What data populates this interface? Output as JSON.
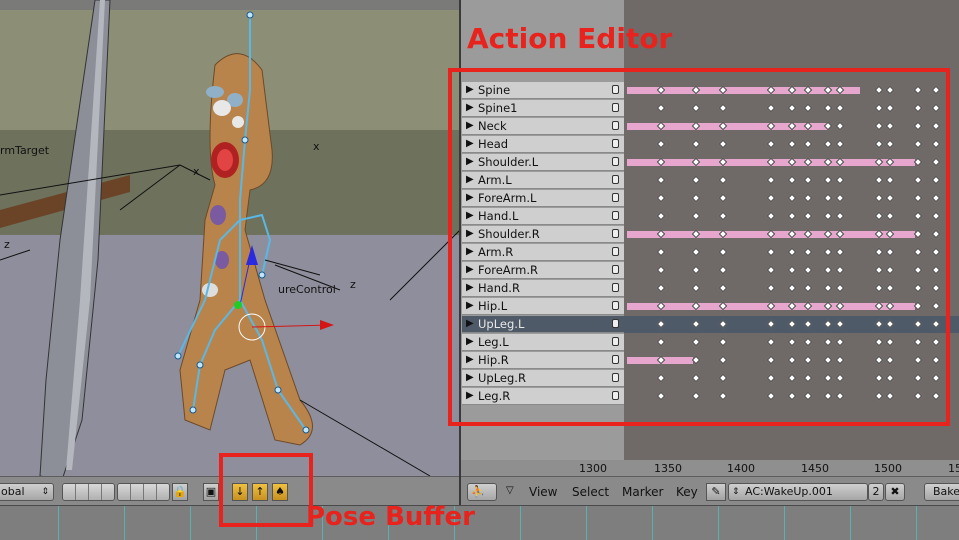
{
  "viewport": {
    "labels": {
      "target": "rmTarget",
      "control": "ureControl",
      "z1": "z",
      "z2": "z",
      "x1": "x",
      "x2": "x"
    }
  },
  "viewport_header": {
    "orientation_select": "obal",
    "lock_icon": "lock-icon"
  },
  "annotations": {
    "action_editor_label": "Action Editor",
    "pose_buffer_label": "Pose Buffer",
    "color": "#e8221c"
  },
  "action_editor": {
    "channels": [
      {
        "name": "Spine",
        "selected": false
      },
      {
        "name": "Spine1",
        "selected": false
      },
      {
        "name": "Neck",
        "selected": false
      },
      {
        "name": "Head",
        "selected": false
      },
      {
        "name": "Shoulder.L",
        "selected": false
      },
      {
        "name": "Arm.L",
        "selected": false
      },
      {
        "name": "ForeArm.L",
        "selected": false
      },
      {
        "name": "Hand.L",
        "selected": false
      },
      {
        "name": "Shoulder.R",
        "selected": false
      },
      {
        "name": "Arm.R",
        "selected": false
      },
      {
        "name": "ForeArm.R",
        "selected": false
      },
      {
        "name": "Hand.R",
        "selected": false
      },
      {
        "name": "Hip.L",
        "selected": false
      },
      {
        "name": "UpLeg.L",
        "selected": true
      },
      {
        "name": "Leg.L",
        "selected": false
      },
      {
        "name": "Hip.R",
        "selected": false
      },
      {
        "name": "UpLeg.R",
        "selected": false
      },
      {
        "name": "Leg.R",
        "selected": false
      }
    ],
    "ruler": [
      "1300",
      "1350",
      "1400",
      "1450",
      "1500",
      "15"
    ],
    "key_color": "#e7a6ce"
  },
  "ae_header": {
    "menus": [
      "View",
      "Select",
      "Marker",
      "Key"
    ],
    "action_name": "AC:WakeUp.001",
    "user_count": "2",
    "close_label": "✖",
    "bake_label": "Bake"
  }
}
